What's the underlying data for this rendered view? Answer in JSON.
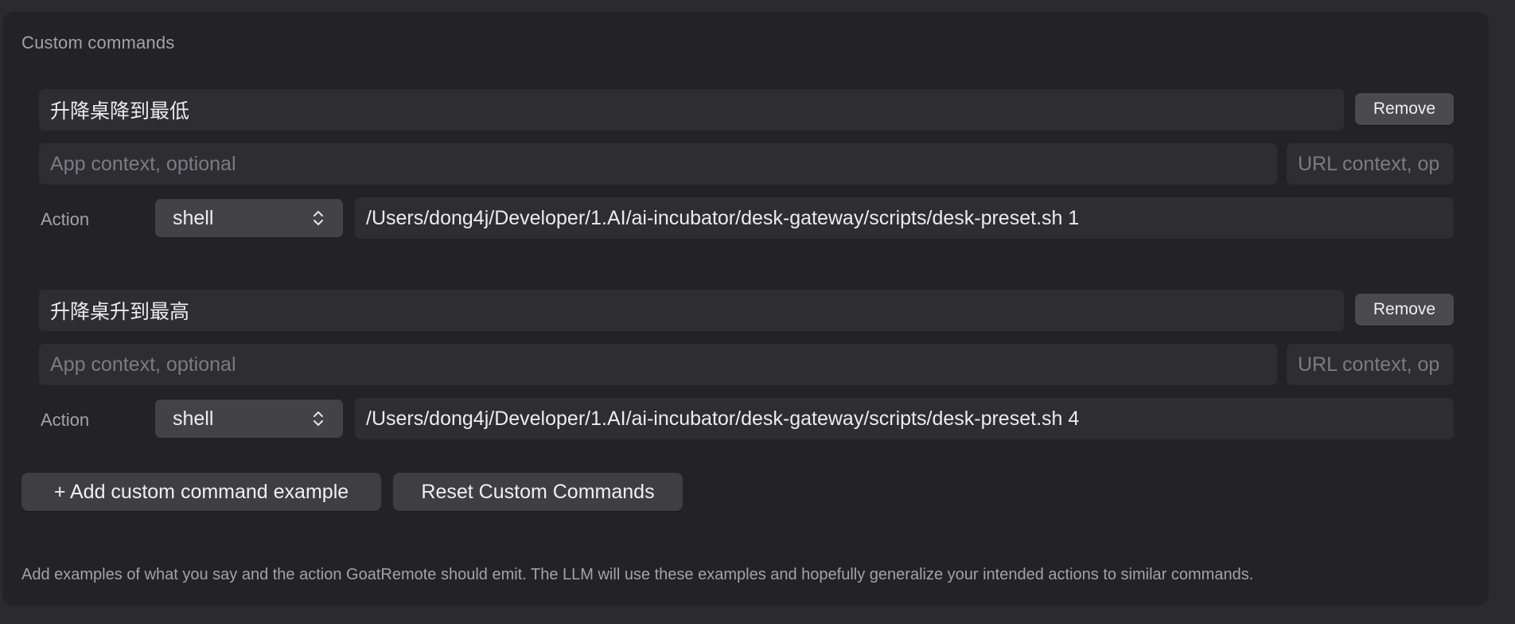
{
  "section": {
    "title": "Custom commands"
  },
  "commands": [
    {
      "phrase": "升降桌降到最低",
      "remove_label": "Remove",
      "app_context_placeholder": "App context, optional",
      "url_context_placeholder": "URL context, op",
      "action_label": "Action",
      "action_type": "shell",
      "action_value": "/Users/dong4j/Developer/1.AI/ai-incubator/desk-gateway/scripts/desk-preset.sh 1"
    },
    {
      "phrase": "升降桌升到最高",
      "remove_label": "Remove",
      "app_context_placeholder": "App context, optional",
      "url_context_placeholder": "URL context, op",
      "action_label": "Action",
      "action_type": "shell",
      "action_value": "/Users/dong4j/Developer/1.AI/ai-incubator/desk-gateway/scripts/desk-preset.sh 4"
    }
  ],
  "buttons": {
    "add_label": "+ Add custom command example",
    "reset_label": "Reset Custom Commands"
  },
  "footer": {
    "note": "Add examples of what you say and the action GoatRemote should emit. The LLM will use these examples and hopefully generalize your intended actions to similar commands."
  },
  "icons": {
    "select_chevron": "chevron-up-down-icon"
  },
  "colors": {
    "background": "#2b2a2e",
    "panel": "#232226",
    "field": "#2e2d31",
    "button": "#4a494e"
  }
}
